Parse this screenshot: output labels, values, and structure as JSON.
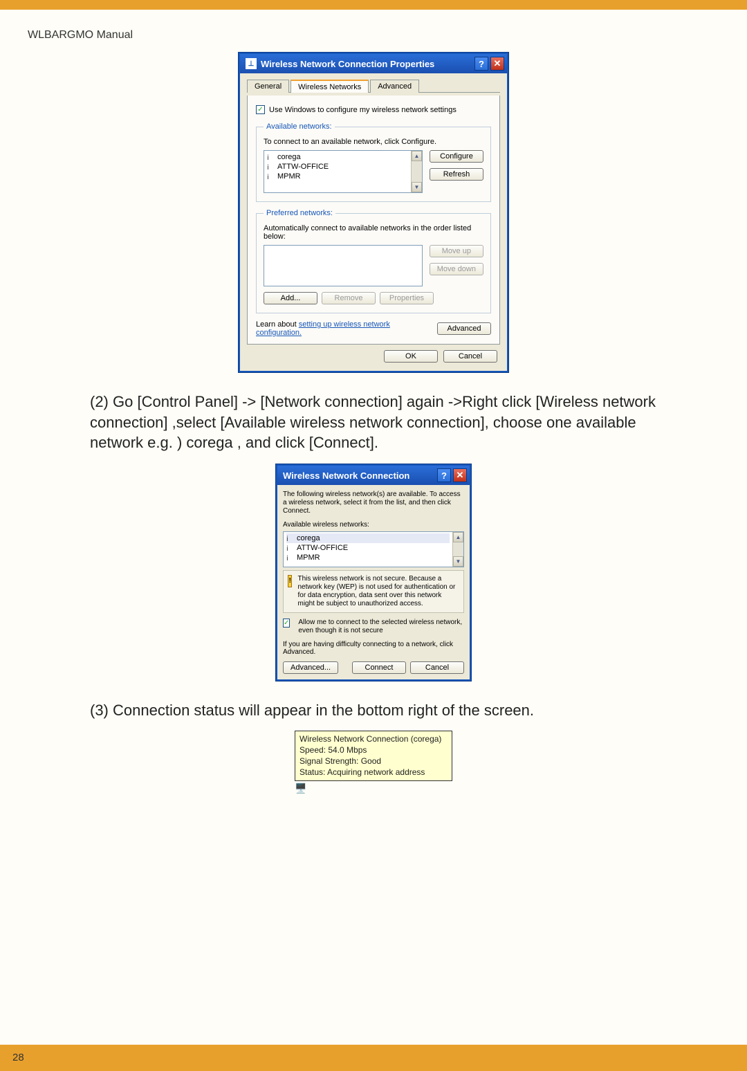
{
  "header": {
    "manual_title": "WLBARGMO Manual"
  },
  "page_number": "28",
  "dialog1": {
    "title": "Wireless Network Connection Properties",
    "tabs": {
      "general": "General",
      "wireless": "Wireless Networks",
      "advanced": "Advanced"
    },
    "use_windows": "Use Windows to configure my wireless network settings",
    "available": {
      "legend": "Available networks:",
      "desc": "To connect to an available network, click Configure.",
      "items": [
        "corega",
        "ATTW-OFFICE",
        "MPMR"
      ],
      "configure_btn": "Configure",
      "refresh_btn": "Refresh"
    },
    "preferred": {
      "legend": "Preferred networks:",
      "desc": "Automatically connect to available networks in the order listed below:",
      "move_up": "Move up",
      "move_down": "Move down",
      "add_btn": "Add...",
      "remove_btn": "Remove",
      "props_btn": "Properties"
    },
    "learn_text": "Learn about ",
    "learn_link": "setting up wireless network configuration.",
    "advanced_btn": "Advanced",
    "ok_btn": "OK",
    "cancel_btn": "Cancel"
  },
  "step2": "(2) Go [Control Panel] -> [Network connection] again ->Right click [Wireless network connection] ,select [Available wireless network connection], choose one available network e.g. ) corega , and click [Connect].",
  "dialog2": {
    "title": "Wireless Network Connection",
    "desc": "The following wireless network(s) are available. To access a wireless network, select it from the list, and then click Connect.",
    "avail_label": "Available wireless networks:",
    "items": [
      "corega",
      "ATTW-OFFICE",
      "MPMR"
    ],
    "warn": "This wireless network is not secure. Because a network key (WEP) is not used for authentication or for data encryption, data sent over this network might be subject to unauthorized access.",
    "allow": "Allow me to connect to the selected wireless network, even though it is not secure",
    "difficulty": "If you are having difficulty connecting to a network, click Advanced.",
    "advanced_btn": "Advanced...",
    "connect_btn": "Connect",
    "cancel_btn": "Cancel"
  },
  "step3": "(3) Connection status will appear in the bottom right of the screen.",
  "tooltip": {
    "line1": "Wireless Network Connection (corega)",
    "line2": "Speed: 54.0 Mbps",
    "line3": "Signal Strength: Good",
    "line4": "Status: Acquiring network address"
  }
}
